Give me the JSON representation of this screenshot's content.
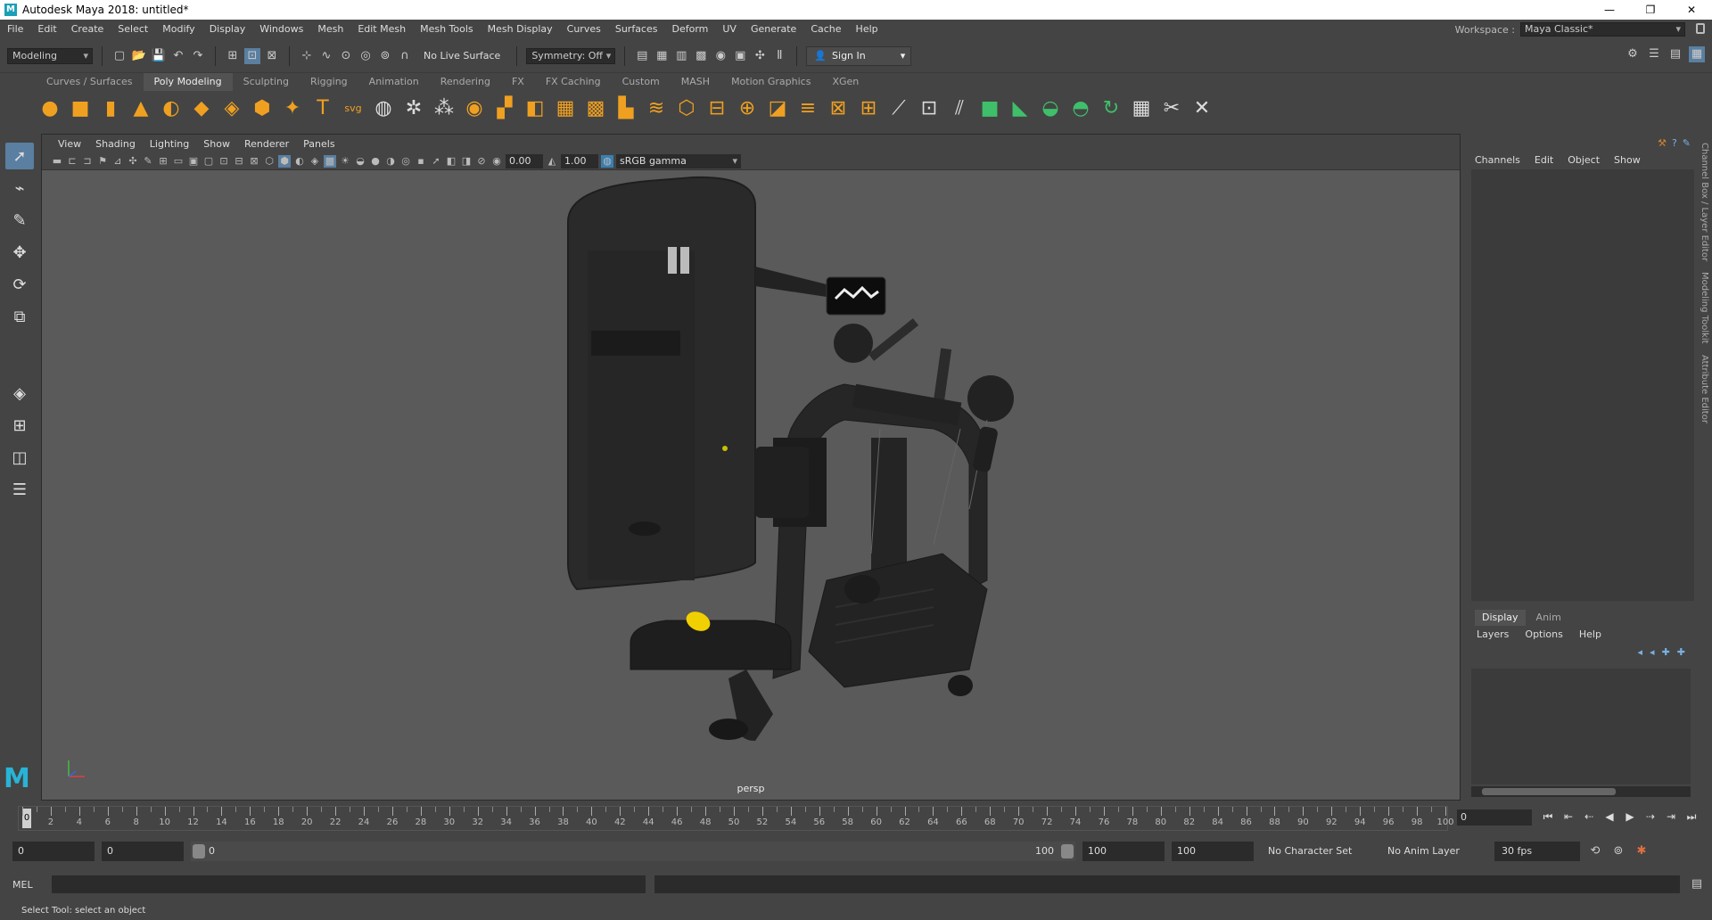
{
  "window": {
    "title": "Autodesk Maya 2018: untitled*",
    "app_icon": "M"
  },
  "menus": [
    "File",
    "Edit",
    "Create",
    "Select",
    "Modify",
    "Display",
    "Windows",
    "Mesh",
    "Edit Mesh",
    "Mesh Tools",
    "Mesh Display",
    "Curves",
    "Surfaces",
    "Deform",
    "UV",
    "Generate",
    "Cache",
    "Help"
  ],
  "workspace": {
    "label": "Workspace :",
    "value": "Maya Classic*"
  },
  "statusline": {
    "mode": "Modeling",
    "live_surface": "No Live Surface",
    "symmetry": "Symmetry: Off",
    "signin": "Sign In"
  },
  "shelf_tabs": [
    "Curves / Surfaces",
    "Poly Modeling",
    "Sculpting",
    "Rigging",
    "Animation",
    "Rendering",
    "FX",
    "FX Caching",
    "Custom",
    "MASH",
    "Motion Graphics",
    "XGen"
  ],
  "shelf_active": "Poly Modeling",
  "panel_menu": [
    "View",
    "Shading",
    "Lighting",
    "Show",
    "Renderer",
    "Panels"
  ],
  "panel_tools": {
    "exposure": "0.00",
    "gamma": "1.00",
    "color_space": "sRGB gamma"
  },
  "viewport": {
    "camera": "persp"
  },
  "channel_box": {
    "menu": [
      "Channels",
      "Edit",
      "Object",
      "Show"
    ]
  },
  "layer_editor": {
    "tabs": [
      "Display",
      "Anim"
    ],
    "active_tab": "Display",
    "menu": [
      "Layers",
      "Options",
      "Help"
    ]
  },
  "side_tabs": [
    "Channel Box / Layer Editor",
    "Modeling Toolkit",
    "Attribute Editor"
  ],
  "timeline": {
    "labels": [
      0,
      2,
      4,
      6,
      8,
      10,
      12,
      14,
      16,
      18,
      20,
      22,
      24,
      26,
      28,
      30,
      32,
      34,
      36,
      38,
      40,
      42,
      44,
      46,
      48,
      50,
      52,
      54,
      56,
      58,
      60,
      62,
      64,
      66,
      68,
      70,
      72,
      74,
      76,
      78,
      80,
      82,
      84,
      86,
      88,
      90,
      92,
      94,
      96,
      98,
      100
    ],
    "current_frame": "0",
    "current_field": "0"
  },
  "range": {
    "start": "0",
    "min": "0",
    "slider_start": "0",
    "slider_end": "100",
    "end": "100",
    "max": "100",
    "character_set": "No Character Set",
    "anim_layer": "No Anim Layer",
    "fps": "30 fps"
  },
  "command": {
    "lang": "MEL"
  },
  "help_line": "Select Tool: select an object"
}
